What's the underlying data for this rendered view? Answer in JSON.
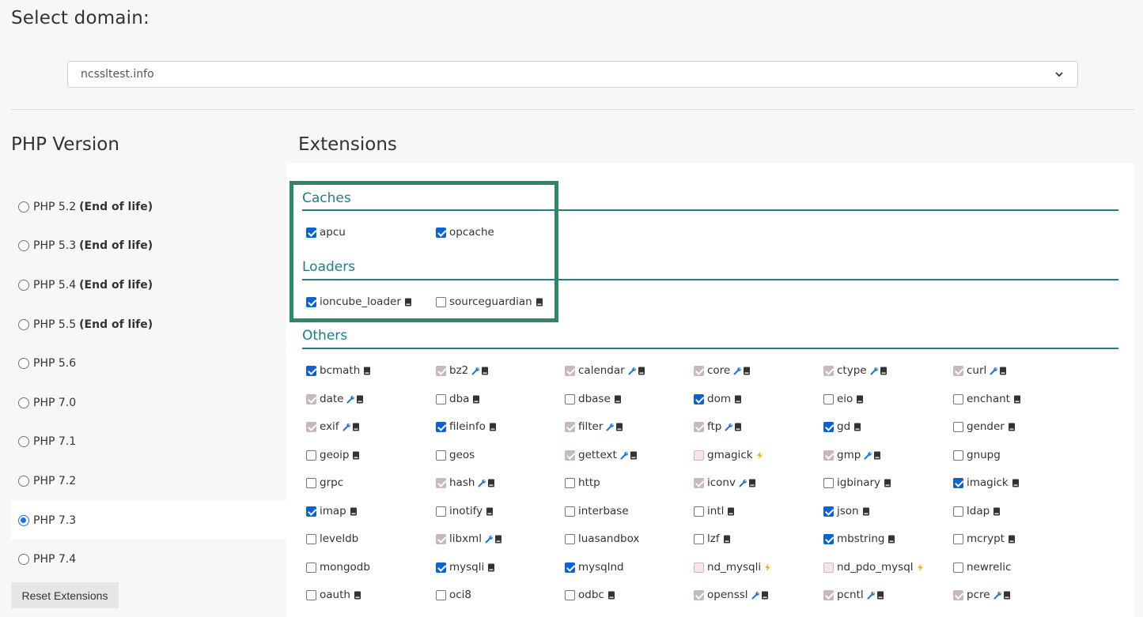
{
  "page": {
    "title": "Select domain:",
    "domain_value": "ncssltest.info",
    "php_heading": "PHP Version",
    "ext_heading": "Extensions",
    "reset_label": "Reset Extensions"
  },
  "php_versions": [
    {
      "label": "PHP 5.2",
      "note": "(End of life)",
      "selected": false
    },
    {
      "label": "PHP 5.3",
      "note": "(End of life)",
      "selected": false
    },
    {
      "label": "PHP 5.4",
      "note": "(End of life)",
      "selected": false
    },
    {
      "label": "PHP 5.5",
      "note": "(End of life)",
      "selected": false
    },
    {
      "label": "PHP 5.6",
      "note": "",
      "selected": false
    },
    {
      "label": "PHP 7.0",
      "note": "",
      "selected": false
    },
    {
      "label": "PHP 7.1",
      "note": "",
      "selected": false
    },
    {
      "label": "PHP 7.2",
      "note": "",
      "selected": false
    },
    {
      "label": "PHP 7.3",
      "note": "",
      "selected": true
    },
    {
      "label": "PHP 7.4",
      "note": "",
      "selected": false
    }
  ],
  "colors": {
    "accent": "#1b7f8c",
    "checkbox_checked": "#0b61d6",
    "checkbox_locked": "#c8b8b8",
    "highlight_border": "#2b8a62",
    "wrench_icon": "#1a73e8",
    "bolt_icon": "#f0b429"
  },
  "sections": {
    "caches": {
      "title": "Caches",
      "items": [
        {
          "name": "apcu",
          "state": "checked",
          "icons": []
        },
        {
          "name": "opcache",
          "state": "checked",
          "icons": []
        }
      ]
    },
    "loaders": {
      "title": "Loaders",
      "items": [
        {
          "name": "ioncube_loader",
          "state": "checked",
          "icons": [
            "book-icon"
          ]
        },
        {
          "name": "sourceguardian",
          "state": "unchecked",
          "icons": [
            "book-icon"
          ]
        }
      ]
    },
    "others": {
      "title": "Others",
      "items": [
        {
          "name": "bcmath",
          "state": "checked",
          "icons": [
            "book-icon"
          ]
        },
        {
          "name": "bz2",
          "state": "locked",
          "icons": [
            "wrench-icon",
            "book-icon"
          ]
        },
        {
          "name": "calendar",
          "state": "locked",
          "icons": [
            "wrench-icon",
            "book-icon"
          ]
        },
        {
          "name": "core",
          "state": "locked",
          "icons": [
            "wrench-icon",
            "book-icon"
          ]
        },
        {
          "name": "ctype",
          "state": "locked",
          "icons": [
            "wrench-icon",
            "book-icon"
          ]
        },
        {
          "name": "curl",
          "state": "locked",
          "icons": [
            "wrench-icon",
            "book-icon"
          ]
        },
        {
          "name": "date",
          "state": "locked",
          "icons": [
            "wrench-icon",
            "book-icon"
          ]
        },
        {
          "name": "dba",
          "state": "unchecked",
          "icons": [
            "book-icon"
          ]
        },
        {
          "name": "dbase",
          "state": "unchecked",
          "icons": [
            "book-icon"
          ]
        },
        {
          "name": "dom",
          "state": "checked",
          "icons": [
            "book-icon"
          ]
        },
        {
          "name": "eio",
          "state": "unchecked",
          "icons": [
            "book-icon"
          ]
        },
        {
          "name": "enchant",
          "state": "unchecked",
          "icons": [
            "book-icon"
          ]
        },
        {
          "name": "exif",
          "state": "locked",
          "icons": [
            "wrench-icon",
            "book-icon"
          ]
        },
        {
          "name": "fileinfo",
          "state": "checked",
          "icons": [
            "book-icon"
          ]
        },
        {
          "name": "filter",
          "state": "locked",
          "icons": [
            "wrench-icon",
            "book-icon"
          ]
        },
        {
          "name": "ftp",
          "state": "locked",
          "icons": [
            "wrench-icon",
            "book-icon"
          ]
        },
        {
          "name": "gd",
          "state": "checked",
          "icons": [
            "book-icon"
          ]
        },
        {
          "name": "gender",
          "state": "unchecked",
          "icons": [
            "book-icon"
          ]
        },
        {
          "name": "geoip",
          "state": "unchecked",
          "icons": [
            "book-icon"
          ]
        },
        {
          "name": "geos",
          "state": "unchecked",
          "icons": []
        },
        {
          "name": "gettext",
          "state": "locked",
          "icons": [
            "wrench-icon",
            "book-icon"
          ]
        },
        {
          "name": "gmagick",
          "state": "pink",
          "icons": [
            "bolt-icon"
          ]
        },
        {
          "name": "gmp",
          "state": "locked",
          "icons": [
            "wrench-icon",
            "book-icon"
          ]
        },
        {
          "name": "gnupg",
          "state": "unchecked",
          "icons": []
        },
        {
          "name": "grpc",
          "state": "unchecked",
          "icons": []
        },
        {
          "name": "hash",
          "state": "locked",
          "icons": [
            "wrench-icon",
            "book-icon"
          ]
        },
        {
          "name": "http",
          "state": "unchecked",
          "icons": []
        },
        {
          "name": "iconv",
          "state": "locked",
          "icons": [
            "wrench-icon",
            "book-icon"
          ]
        },
        {
          "name": "igbinary",
          "state": "unchecked",
          "icons": [
            "book-icon"
          ]
        },
        {
          "name": "imagick",
          "state": "checked",
          "icons": [
            "book-icon"
          ]
        },
        {
          "name": "imap",
          "state": "checked",
          "icons": [
            "book-icon"
          ]
        },
        {
          "name": "inotify",
          "state": "unchecked",
          "icons": [
            "book-icon"
          ]
        },
        {
          "name": "interbase",
          "state": "unchecked",
          "icons": []
        },
        {
          "name": "intl",
          "state": "unchecked",
          "icons": [
            "book-icon"
          ]
        },
        {
          "name": "json",
          "state": "checked",
          "icons": [
            "book-icon"
          ]
        },
        {
          "name": "ldap",
          "state": "unchecked",
          "icons": [
            "book-icon"
          ]
        },
        {
          "name": "leveldb",
          "state": "unchecked",
          "icons": []
        },
        {
          "name": "libxml",
          "state": "locked",
          "icons": [
            "wrench-icon",
            "book-icon"
          ]
        },
        {
          "name": "luasandbox",
          "state": "unchecked",
          "icons": []
        },
        {
          "name": "lzf",
          "state": "unchecked",
          "icons": [
            "book-icon"
          ]
        },
        {
          "name": "mbstring",
          "state": "checked",
          "icons": [
            "book-icon"
          ]
        },
        {
          "name": "mcrypt",
          "state": "unchecked",
          "icons": [
            "book-icon"
          ]
        },
        {
          "name": "mongodb",
          "state": "unchecked",
          "icons": []
        },
        {
          "name": "mysqli",
          "state": "checked",
          "icons": [
            "book-icon"
          ]
        },
        {
          "name": "mysqlnd",
          "state": "checked",
          "icons": []
        },
        {
          "name": "nd_mysqli",
          "state": "pink",
          "icons": [
            "bolt-icon"
          ]
        },
        {
          "name": "nd_pdo_mysql",
          "state": "pink",
          "icons": [
            "bolt-icon"
          ]
        },
        {
          "name": "newrelic",
          "state": "unchecked",
          "icons": []
        },
        {
          "name": "oauth",
          "state": "unchecked",
          "icons": [
            "book-icon"
          ]
        },
        {
          "name": "oci8",
          "state": "unchecked",
          "icons": []
        },
        {
          "name": "odbc",
          "state": "unchecked",
          "icons": [
            "book-icon"
          ]
        },
        {
          "name": "openssl",
          "state": "locked",
          "icons": [
            "wrench-icon",
            "book-icon"
          ]
        },
        {
          "name": "pcntl",
          "state": "locked",
          "icons": [
            "wrench-icon",
            "book-icon"
          ]
        },
        {
          "name": "pcre",
          "state": "locked",
          "icons": [
            "wrench-icon",
            "book-icon"
          ]
        }
      ]
    }
  }
}
